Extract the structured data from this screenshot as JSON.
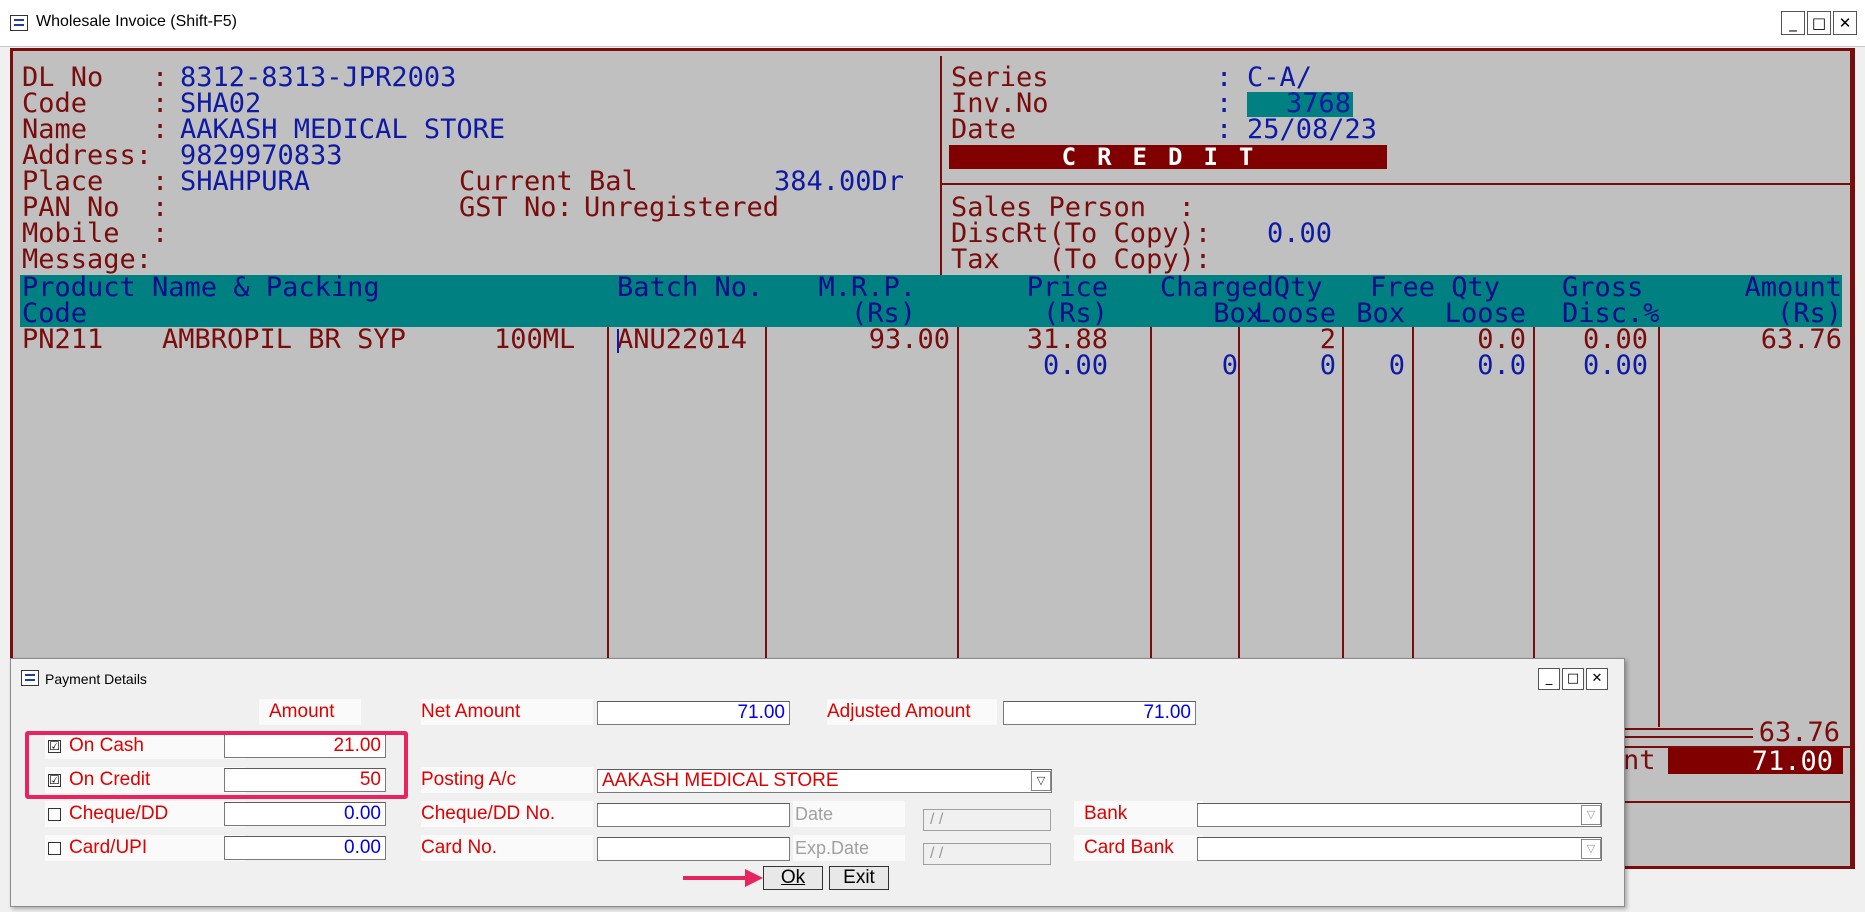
{
  "window": {
    "title": "Wholesale Invoice (Shift-F5)",
    "min": "_",
    "max": "□",
    "close": "✕"
  },
  "party": {
    "dl_label": "DL No   :",
    "dl": "8312-8313-JPR2003",
    "code_label": "Code    :",
    "code": "SHA02",
    "name_label": "Name    :",
    "name": "AAKASH MEDICAL STORE",
    "address_label": "Address:",
    "address": "9829970833",
    "place_label": "Place   :",
    "place": "SHAHPURA",
    "pan_label": "PAN No  :",
    "mobile_label": "Mobile  :",
    "message_label": "Message:",
    "curbal_label": "Current Bal",
    "curbal": "384.00Dr",
    "gst_label": "GST No:",
    "gst": "Unregistered"
  },
  "invoice": {
    "series_label": "Series",
    "series": "C-A/",
    "invno_label": "Inv.No",
    "invno": "3768",
    "date_label": "Date",
    "date": "25/08/23",
    "colon": ":",
    "mode": "CREDIT",
    "sales_person_label": "Sales Person  :",
    "discrt_label": "DiscRt(To Copy):",
    "discrt": "0.00",
    "tax_label": "Tax   (To Copy):"
  },
  "grid": {
    "headers": {
      "product_top": "Product Name & Packing",
      "product_bot": "Code",
      "batch": "Batch No.",
      "mrp_top": "M.R.P.",
      "mrp_bot": "(Rs)",
      "price_top": "Price",
      "price_bot": "(Rs)",
      "charged_top": "ChargedQty",
      "charged_box": "Box",
      "charged_loose": "Loose",
      "free_top": "Free Qty",
      "free_box": "Box",
      "free_loose": "Loose",
      "gross_top": "Gross",
      "gross_bot": "Disc.%",
      "amount_top": "Amount",
      "amount_bot": "(Rs)"
    },
    "row1": {
      "code": "PN211",
      "name": "AMBROPIL BR SYP",
      "pack": "100ML",
      "batch": "ANU22014",
      "mrp": "93.00",
      "price": "31.88",
      "cbox": "",
      "cloose": "2",
      "fbox": "",
      "floose": "0.0",
      "disc": "0.00",
      "amount": "63.76"
    },
    "row2": {
      "price": "0.00",
      "cbox": "0",
      "cloose": "0",
      "fbox": "0",
      "floose": "0.0",
      "disc": "0.00"
    }
  },
  "totals": {
    "subtotal": "63.76",
    "net_label_tail": "nt",
    "net": "71.00"
  },
  "payment": {
    "title": "Payment Details",
    "amount_header": "Amount",
    "cash": {
      "label": "On Cash",
      "checked": "☑",
      "value": "21.00"
    },
    "credit": {
      "label": "On Credit",
      "checked": "☑",
      "value": "50"
    },
    "cheque": {
      "label": "Cheque/DD",
      "value": "0.00"
    },
    "card": {
      "label": "Card/UPI",
      "value": "0.00"
    },
    "net_amount_label": "Net Amount",
    "net_amount": "71.00",
    "adjusted_label": "Adjusted Amount",
    "adjusted": "71.00",
    "posting_label": "Posting A/c",
    "posting": "AAKASH MEDICAL STORE",
    "cheque_no_label": "Cheque/DD No.",
    "date_label": "Date",
    "date_value": "/ /",
    "bank_label": "Bank",
    "card_no_label": "Card No.",
    "exp_label": "Exp.Date",
    "exp_value": "/ /",
    "card_bank_label": "Card Bank",
    "ok": "Ok",
    "exit": "Exit"
  },
  "colors": {
    "maroon": "#7a0c0c",
    "teal": "#008080",
    "blue": "#0e1aa3",
    "highlight": "#e8245f"
  },
  "icons": {
    "system": "system-menu-icon",
    "dropdown": "dropdown-arrow-icon",
    "checkbox": "checkbox-icon"
  }
}
